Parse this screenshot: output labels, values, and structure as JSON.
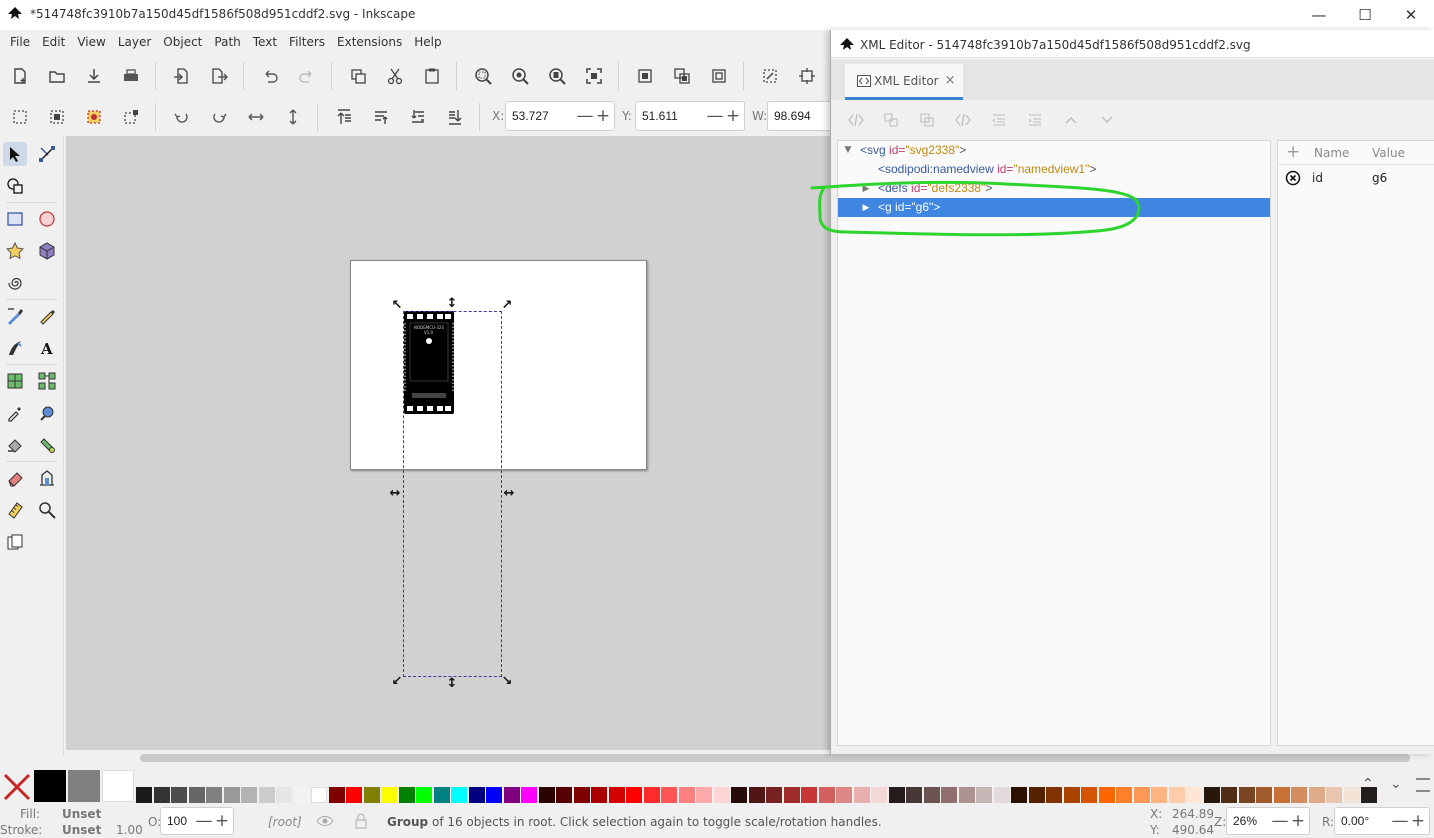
{
  "window": {
    "title": "*514748fc3910b7a150d45df1586f508d951cddf2.svg - Inkscape",
    "controls": [
      "minimize-icon",
      "maximize-icon",
      "close-icon"
    ]
  },
  "menu": [
    "File",
    "Edit",
    "View",
    "Layer",
    "Object",
    "Path",
    "Text",
    "Filters",
    "Extensions",
    "Help"
  ],
  "commands_bar": {
    "icons": [
      "new-document-icon",
      "open-icon",
      "save-icon",
      "print-icon",
      "import-icon",
      "export-icon",
      "undo-icon",
      "redo-icon",
      "duplicate-icon",
      "cut-icon",
      "paste-icon",
      "zoom-selection-icon",
      "zoom-drawing-icon",
      "zoom-page-icon",
      "zoom-fit-icon",
      "group-icon",
      "ungroup-icon",
      "clone-icon",
      "node-editor-icon",
      "transform-icon"
    ]
  },
  "tool_controls": {
    "x_label": "X:",
    "x_value": "53.727",
    "y_label": "Y:",
    "y_value": "51.611",
    "w_label": "W:",
    "w_value": "98.694",
    "minus": "—",
    "plus": "+"
  },
  "toolbox": [
    "selector-icon",
    "node-tool-icon",
    "tweak-tool-icon",
    "rectangle-tool-icon",
    "ellipse-tool-icon",
    "star-tool-icon",
    "3d-box-tool-icon",
    "spiral-tool-icon",
    "pen-tool-icon",
    "pencil-tool-icon",
    "calligraphy-tool-icon",
    "text-tool-icon",
    "mesh-tool-icon",
    "connector-tool-icon",
    "dropper-tool-icon",
    "spray-tool-icon",
    "paint-bucket-icon",
    "gradient-tool-icon",
    "eraser-tool-icon",
    "lpe-tool-icon",
    "measure-tool-icon",
    "zoom-tool-icon",
    "pages-tool-icon"
  ],
  "canvas": {
    "board_label_1": "NODEMCU-32S",
    "board_label_2": "V1.0"
  },
  "xml_editor": {
    "window_title": "XML Editor - 514748fc3910b7a150d45df1586f508d951cddf2.svg",
    "tab_label": "XML Editor",
    "tab_close": "×",
    "nodes": [
      {
        "tag": "<svg",
        "attr": "id=",
        "val": "\"svg2338\"",
        "close": ">"
      },
      {
        "tag": "<sodipodi:namedview",
        "attr": "id=",
        "val": "\"namedview1\"",
        "close": ">"
      },
      {
        "tag": "<defs",
        "attr": "id=",
        "val": "\"defs2338\"",
        "close": ">"
      },
      {
        "tag": "<g",
        "attr": "id=",
        "val": "\"g6\"",
        "close": ">"
      }
    ],
    "attr_header": {
      "add": "+",
      "name": "Name",
      "value": "Value"
    },
    "attributes": [
      {
        "name": "id",
        "value": "g6"
      }
    ]
  },
  "palette": {
    "colors": [
      "#000000",
      "#808080",
      "#ffffff",
      "#1a1a1a",
      "#333333",
      "#4d4d4d",
      "#666666",
      "#808080",
      "#999999",
      "#b3b3b3",
      "#cccccc",
      "#e6e6e6",
      "#f2f2f2",
      "#ffffff",
      "#800000",
      "#ff0000",
      "#808000",
      "#ffff00",
      "#008000",
      "#00ff00",
      "#008080",
      "#00ffff",
      "#000080",
      "#0000ff",
      "#800080",
      "#ff00ff",
      "#2b0000",
      "#550000",
      "#800000",
      "#aa0000",
      "#d40000",
      "#ff0000",
      "#ff2a2a",
      "#ff5555",
      "#ff8080",
      "#ffaaaa",
      "#ffd5d5",
      "#280b0b",
      "#501616",
      "#782121",
      "#a02c2c",
      "#c83737",
      "#d35f5f",
      "#de8787",
      "#e9afaf",
      "#f4d7d7",
      "#241c1c",
      "#483737",
      "#6c5353",
      "#916f6f",
      "#ac9393",
      "#c8b7b7",
      "#e3dbdb",
      "#2b1100",
      "#552200",
      "#803300",
      "#aa4400",
      "#d45500",
      "#ff6600",
      "#ff7f2a",
      "#ff9955",
      "#ffb380",
      "#ffccaa",
      "#ffe6d5",
      "#28170b",
      "#502d16",
      "#784421",
      "#a05a2c",
      "#c87137",
      "#d38d5f",
      "#deaa87",
      "#e9c6af",
      "#f4e3d7",
      "#241f1c"
    ]
  },
  "status": {
    "fill_label": "Fill:",
    "fill_value": "Unset",
    "stroke_label": "Stroke:",
    "stroke_value": "Unset",
    "stroke_width": "1.00",
    "opacity_label": "O:",
    "opacity_value": "100",
    "layer": "[root]",
    "message_bold": "Group",
    "message": " of 16 objects in root. Click selection again to toggle scale/rotation handles.",
    "x_label": "X:",
    "x_value": "264.89",
    "y_label": "Y:",
    "y_value": "490.64",
    "zoom_label": "Z:",
    "zoom_value": "26%",
    "rotate_label": "R:",
    "rotate_value": "0.00°"
  }
}
